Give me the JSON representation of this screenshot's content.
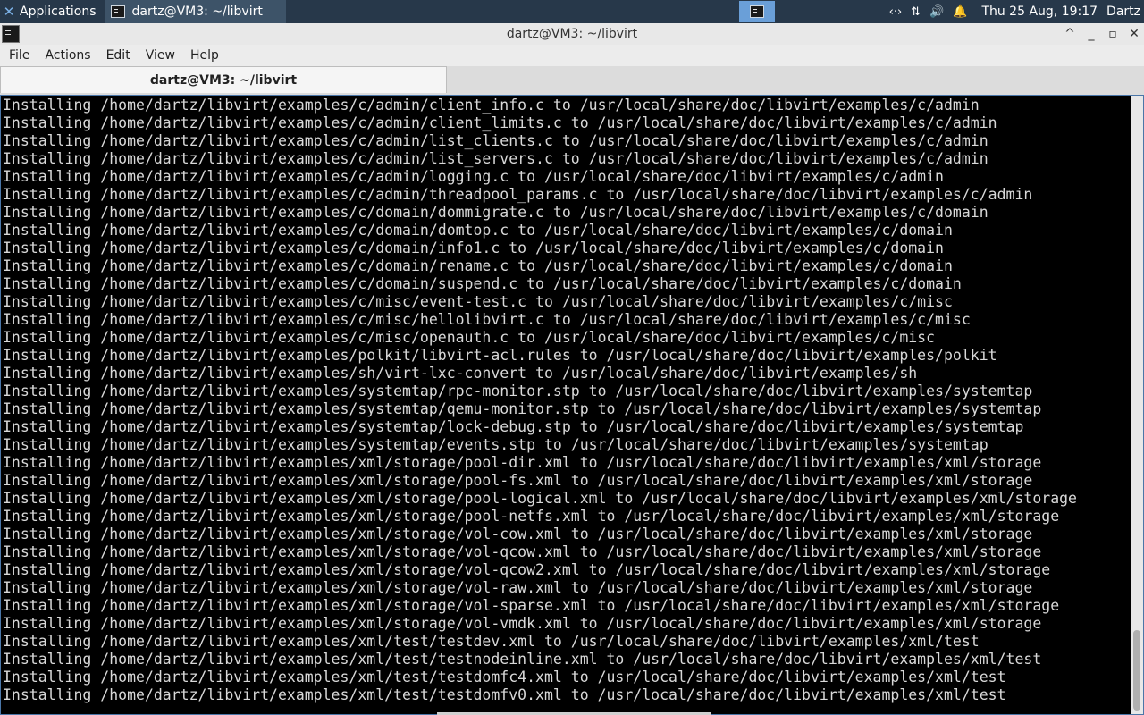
{
  "panel": {
    "apps_label": "Applications",
    "task_label": "dartz@VM3: ~/libvirt",
    "tray_network": "‹·›",
    "tray_transfer": "⇅",
    "tray_volume": "🔊",
    "tray_notify": "🔔",
    "clock": "Thu 25 Aug, 19:17",
    "user": "Dartz"
  },
  "window": {
    "title": "dartz@VM3: ~/libvirt",
    "controls": {
      "up": "^",
      "minimize": "_",
      "maximize": "▫",
      "close": "✕"
    }
  },
  "menu": {
    "file": "File",
    "actions": "Actions",
    "edit": "Edit",
    "view": "View",
    "help": "Help"
  },
  "tab": {
    "label": "dartz@VM3: ~/libvirt"
  },
  "terminal": {
    "lines": [
      "Installing /home/dartz/libvirt/examples/c/admin/client_info.c to /usr/local/share/doc/libvirt/examples/c/admin",
      "Installing /home/dartz/libvirt/examples/c/admin/client_limits.c to /usr/local/share/doc/libvirt/examples/c/admin",
      "Installing /home/dartz/libvirt/examples/c/admin/list_clients.c to /usr/local/share/doc/libvirt/examples/c/admin",
      "Installing /home/dartz/libvirt/examples/c/admin/list_servers.c to /usr/local/share/doc/libvirt/examples/c/admin",
      "Installing /home/dartz/libvirt/examples/c/admin/logging.c to /usr/local/share/doc/libvirt/examples/c/admin",
      "Installing /home/dartz/libvirt/examples/c/admin/threadpool_params.c to /usr/local/share/doc/libvirt/examples/c/admin",
      "Installing /home/dartz/libvirt/examples/c/domain/dommigrate.c to /usr/local/share/doc/libvirt/examples/c/domain",
      "Installing /home/dartz/libvirt/examples/c/domain/domtop.c to /usr/local/share/doc/libvirt/examples/c/domain",
      "Installing /home/dartz/libvirt/examples/c/domain/info1.c to /usr/local/share/doc/libvirt/examples/c/domain",
      "Installing /home/dartz/libvirt/examples/c/domain/rename.c to /usr/local/share/doc/libvirt/examples/c/domain",
      "Installing /home/dartz/libvirt/examples/c/domain/suspend.c to /usr/local/share/doc/libvirt/examples/c/domain",
      "Installing /home/dartz/libvirt/examples/c/misc/event-test.c to /usr/local/share/doc/libvirt/examples/c/misc",
      "Installing /home/dartz/libvirt/examples/c/misc/hellolibvirt.c to /usr/local/share/doc/libvirt/examples/c/misc",
      "Installing /home/dartz/libvirt/examples/c/misc/openauth.c to /usr/local/share/doc/libvirt/examples/c/misc",
      "Installing /home/dartz/libvirt/examples/polkit/libvirt-acl.rules to /usr/local/share/doc/libvirt/examples/polkit",
      "Installing /home/dartz/libvirt/examples/sh/virt-lxc-convert to /usr/local/share/doc/libvirt/examples/sh",
      "Installing /home/dartz/libvirt/examples/systemtap/rpc-monitor.stp to /usr/local/share/doc/libvirt/examples/systemtap",
      "Installing /home/dartz/libvirt/examples/systemtap/qemu-monitor.stp to /usr/local/share/doc/libvirt/examples/systemtap",
      "Installing /home/dartz/libvirt/examples/systemtap/lock-debug.stp to /usr/local/share/doc/libvirt/examples/systemtap",
      "Installing /home/dartz/libvirt/examples/systemtap/events.stp to /usr/local/share/doc/libvirt/examples/systemtap",
      "Installing /home/dartz/libvirt/examples/xml/storage/pool-dir.xml to /usr/local/share/doc/libvirt/examples/xml/storage",
      "Installing /home/dartz/libvirt/examples/xml/storage/pool-fs.xml to /usr/local/share/doc/libvirt/examples/xml/storage",
      "Installing /home/dartz/libvirt/examples/xml/storage/pool-logical.xml to /usr/local/share/doc/libvirt/examples/xml/storage",
      "Installing /home/dartz/libvirt/examples/xml/storage/pool-netfs.xml to /usr/local/share/doc/libvirt/examples/xml/storage",
      "Installing /home/dartz/libvirt/examples/xml/storage/vol-cow.xml to /usr/local/share/doc/libvirt/examples/xml/storage",
      "Installing /home/dartz/libvirt/examples/xml/storage/vol-qcow.xml to /usr/local/share/doc/libvirt/examples/xml/storage",
      "Installing /home/dartz/libvirt/examples/xml/storage/vol-qcow2.xml to /usr/local/share/doc/libvirt/examples/xml/storage",
      "Installing /home/dartz/libvirt/examples/xml/storage/vol-raw.xml to /usr/local/share/doc/libvirt/examples/xml/storage",
      "Installing /home/dartz/libvirt/examples/xml/storage/vol-sparse.xml to /usr/local/share/doc/libvirt/examples/xml/storage",
      "Installing /home/dartz/libvirt/examples/xml/storage/vol-vmdk.xml to /usr/local/share/doc/libvirt/examples/xml/storage",
      "Installing /home/dartz/libvirt/examples/xml/test/testdev.xml to /usr/local/share/doc/libvirt/examples/xml/test",
      "Installing /home/dartz/libvirt/examples/xml/test/testnodeinline.xml to /usr/local/share/doc/libvirt/examples/xml/test",
      "Installing /home/dartz/libvirt/examples/xml/test/testdomfc4.xml to /usr/local/share/doc/libvirt/examples/xml/test",
      "Installing /home/dartz/libvirt/examples/xml/test/testdomfv0.xml to /usr/local/share/doc/libvirt/examples/xml/test"
    ]
  }
}
